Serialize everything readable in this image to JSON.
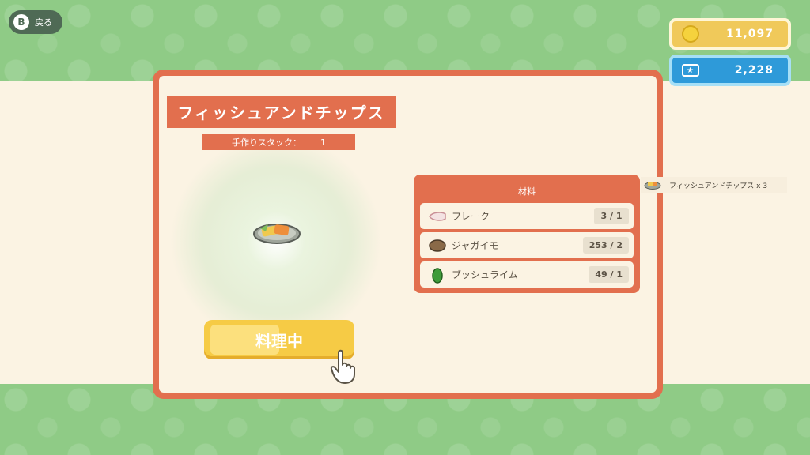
{
  "back": {
    "key": "B",
    "label": "戻る"
  },
  "currency": {
    "bells": "11,097",
    "miles": "2,228"
  },
  "recipe": {
    "title": "フィッシュアンドチップス",
    "stack_label": "手作りスタック：",
    "stack_value": "1"
  },
  "ingredients": {
    "title": "材料",
    "items": [
      {
        "name": "フレーク",
        "count": "3 / 1",
        "icon": "fish-fillet-icon"
      },
      {
        "name": "ジャガイモ",
        "count": "253 / 2",
        "icon": "potato-icon"
      },
      {
        "name": "ブッシュライム",
        "count": "49 / 1",
        "icon": "lime-icon"
      }
    ]
  },
  "cook_button": {
    "label": "料理中",
    "progress": 0.5
  },
  "output": {
    "label": "フィッシュアンドチップス x 3"
  },
  "colors": {
    "accent": "#e26f4e",
    "band_green": "#8fcb86",
    "panel_bg": "#fbf3e3",
    "button_yellow": "#f6cb45",
    "miles_blue": "#2e9ad9"
  }
}
